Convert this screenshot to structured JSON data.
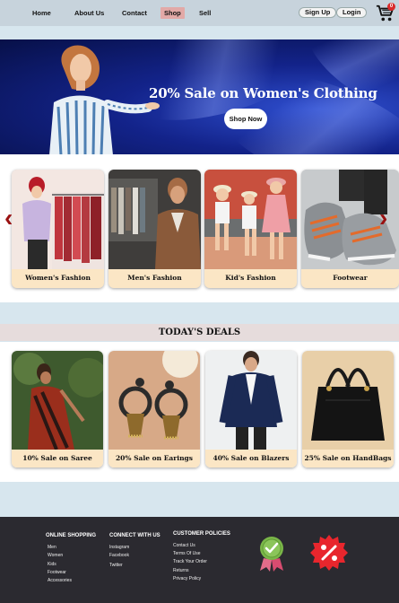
{
  "nav": {
    "links": [
      "Home",
      "About Us",
      "Contact",
      "Shop",
      "Sell"
    ],
    "active": "Shop",
    "signup_label": "Sign Up",
    "login_label": "Login",
    "cart_count": "0"
  },
  "hero": {
    "title": "20% Sale on Women's Clothing",
    "button_label": "Shop Now"
  },
  "categories": [
    {
      "label": "Women's Fashion"
    },
    {
      "label": "Men's Fashion"
    },
    {
      "label": "Kid's Fashion"
    },
    {
      "label": "Footwear"
    }
  ],
  "deals": {
    "title": "TODAY'S DEALS",
    "items": [
      {
        "label": "10% Sale on Saree"
      },
      {
        "label": "20% Sale on Earings"
      },
      {
        "label": "40% Sale on Blazers"
      },
      {
        "label": "25% Sale on HandBags"
      }
    ]
  },
  "footer": {
    "online_shopping": {
      "heading": "ONLINE SHOPPING",
      "links": [
        "Men",
        "Women",
        "Kids",
        "Footwear",
        "Accessories"
      ]
    },
    "connect": {
      "heading": "CONNECT WITH US",
      "links": [
        "Instagram",
        "Facebook",
        "Twitter"
      ]
    },
    "policies": {
      "heading": "CUSTOMER POLICIES",
      "links": [
        "Contact Us",
        "Terms Of Use",
        "Track Your Order",
        "Returns",
        "Privacy Policy"
      ]
    }
  },
  "icons": {
    "cart": "shopping-cart-icon",
    "prev": "chevron-left-icon",
    "next": "chevron-right-icon",
    "quality": "quality-badge-icon",
    "discount": "discount-badge-icon"
  },
  "colors": {
    "nav_bg": "#c7d3dc",
    "page_bg": "#d7e6ee",
    "label_bg": "#fbe6c5",
    "accent_red": "#9a1111",
    "footer_bg": "#2b2a30",
    "badge_green": "#7ab648",
    "badge_red": "#e8262d"
  }
}
